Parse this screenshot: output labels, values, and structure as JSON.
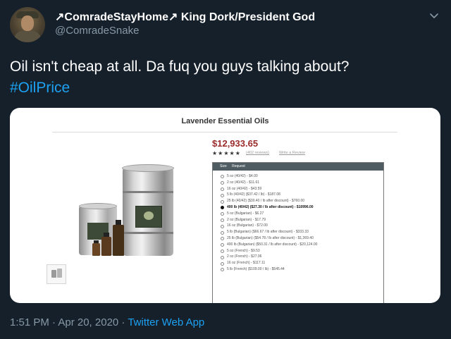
{
  "tweet": {
    "display_name": "↗ComradeStayHome↗ King Dork/President God",
    "handle": "@ComradeSnake",
    "text": "Oil isn't cheap at all. Da fuq you guys talking about?",
    "hashtag": "#OilPrice",
    "timestamp": "1:51 PM · Apr 20, 2020",
    "separator": " · ",
    "source": "Twitter Web App"
  },
  "icons": {
    "more": "chevron-down-icon",
    "avatar": "profile-avatar"
  },
  "media": {
    "product_title": "Lavender Essential Oils",
    "price": "$12,933.65",
    "stars": "★★★★★",
    "reviews_link": "(402 reviews)",
    "write_review": "Write a Review",
    "size_header": "Size",
    "request_header": "Request",
    "options": [
      {
        "label": "5 oz (40/42) - $4.00",
        "selected": false
      },
      {
        "label": "2 oz (40/42) - $11.61",
        "selected": false
      },
      {
        "label": "16 oz (40/42) - $43.59",
        "selected": false
      },
      {
        "label": "5 lb (40/42) ($37.42 / lb) - $187.08",
        "selected": false
      },
      {
        "label": "25 lb (40/42) ($30.40 / lb after discount) - $760.00",
        "selected": false
      },
      {
        "label": "400 lb (40/42) ($27.30 / lb after discount) - $10996.00",
        "selected": true
      },
      {
        "label": "5 oz (Bulgarian) - $6.27",
        "selected": false
      },
      {
        "label": "2 oz (Bulgarian) - $17.79",
        "selected": false
      },
      {
        "label": "16 oz (Bulgarian) - $72.00",
        "selected": false
      },
      {
        "label": "5 lb (Bulgarian) ($66.67 / lb after discount) - $333.33",
        "selected": false
      },
      {
        "label": "25 lb (Bulgarian) ($54.78 / lb after discount) - $1,369.40",
        "selected": false
      },
      {
        "label": "400 lb (Bulgarian) ($50.31 / lb after discount) - $20,124.00",
        "selected": false
      },
      {
        "label": "5 oz (French) - $9.53",
        "selected": false
      },
      {
        "label": "2 oz (French) - $27.06",
        "selected": false
      },
      {
        "label": "16 oz (French) - $117.11",
        "selected": false
      },
      {
        "label": "5 lb (French) ($109.00 / lb) - $545.44",
        "selected": false
      }
    ]
  },
  "colors": {
    "background": "#15202b",
    "text": "#ffffff",
    "muted": "#8899a6",
    "link": "#1da1f2",
    "price": "#9b2a2a",
    "table_header": "#4f5d63"
  }
}
